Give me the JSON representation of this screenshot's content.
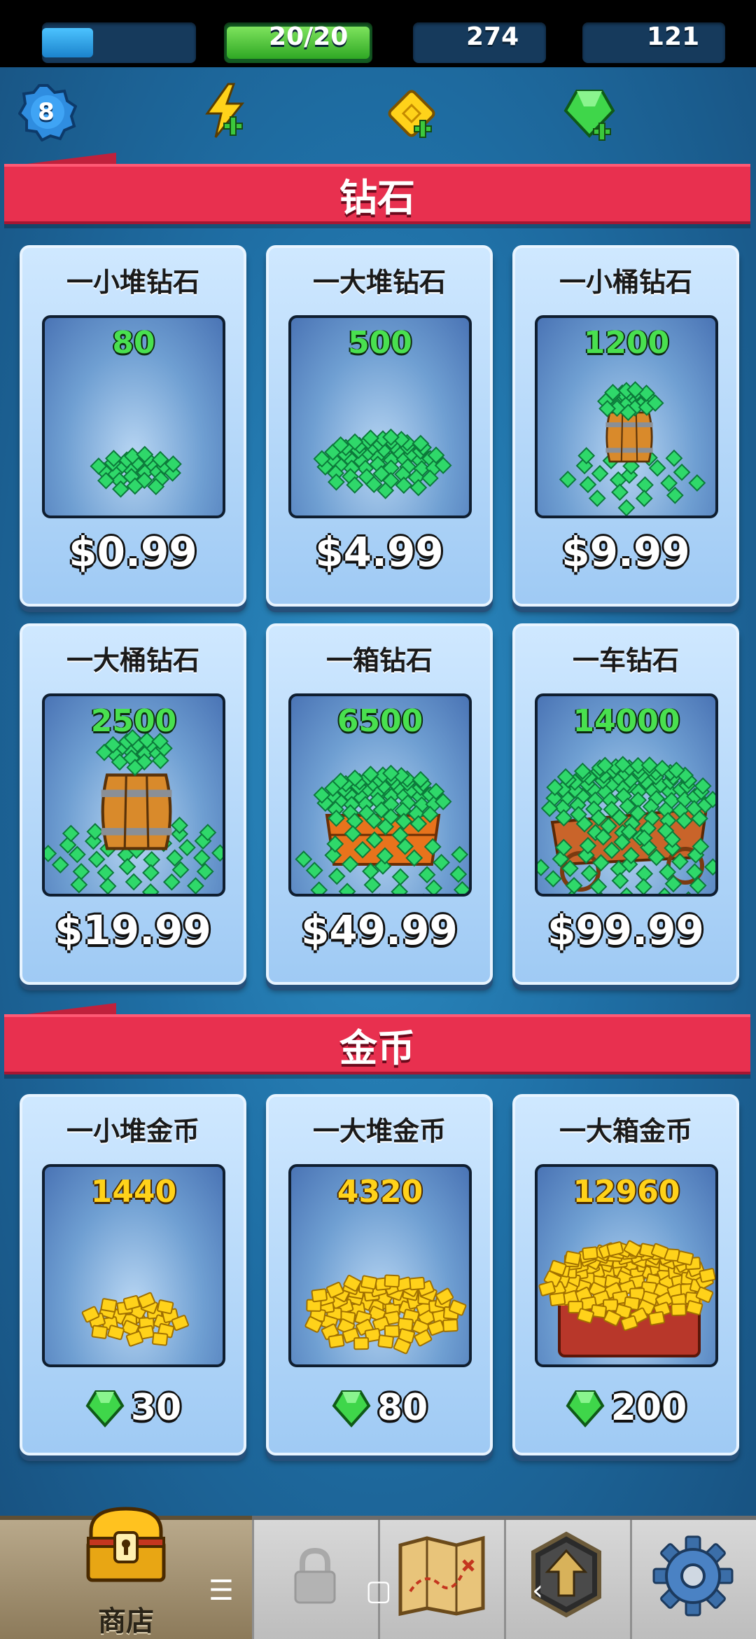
{
  "player": {
    "level": "8",
    "level_progress": 0.33,
    "energy": "20/20",
    "gold": "274",
    "gems": "121"
  },
  "sections": {
    "gems_title": "钻石",
    "coins_title": "金币"
  },
  "gem_packs": [
    {
      "title": "一小堆钻石",
      "amount": "80",
      "price": "$0.99"
    },
    {
      "title": "一大堆钻石",
      "amount": "500",
      "price": "$4.99"
    },
    {
      "title": "一小桶钻石",
      "amount": "1200",
      "price": "$9.99"
    },
    {
      "title": "一大桶钻石",
      "amount": "2500",
      "price": "$19.99"
    },
    {
      "title": "一箱钻石",
      "amount": "6500",
      "price": "$49.99"
    },
    {
      "title": "一车钻石",
      "amount": "14000",
      "price": "$99.99"
    }
  ],
  "coin_packs": [
    {
      "title": "一小堆金币",
      "amount": "1440",
      "cost": "30"
    },
    {
      "title": "一大堆金币",
      "amount": "4320",
      "cost": "80"
    },
    {
      "title": "一大箱金币",
      "amount": "12960",
      "cost": "200"
    }
  ],
  "nav": {
    "shop_label": "商店",
    "items": [
      "shop",
      "locked",
      "map",
      "upgrade",
      "settings"
    ]
  },
  "system_nav": {
    "menu": "☰",
    "home": "▢",
    "back": "‹"
  },
  "colors": {
    "section_header": "#e8304f",
    "gem_green": "#49e04f",
    "gold_yellow": "#ffd21a"
  }
}
